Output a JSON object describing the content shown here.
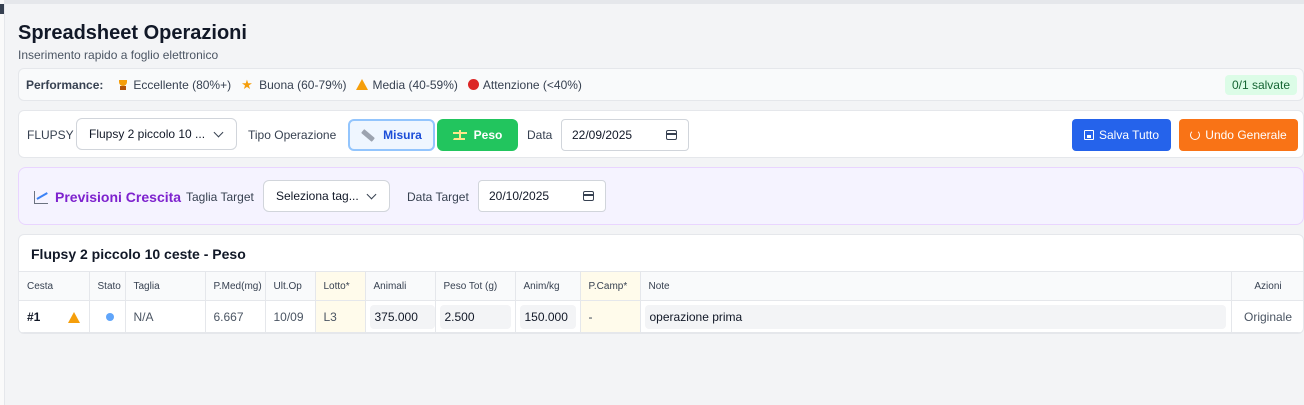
{
  "header": {
    "title": "Spreadsheet Operazioni",
    "subtitle": "Inserimento rapido a foglio elettronico"
  },
  "performance": {
    "label": "Performance:",
    "legend": [
      {
        "icon": "trophy-icon",
        "label": "Eccellente (80%+)"
      },
      {
        "icon": "star-icon",
        "label": "Buona (60-79%)"
      },
      {
        "icon": "warning-icon",
        "label": "Media (40-59%)"
      },
      {
        "icon": "red-dot-icon",
        "label": "Attenzione (<40%)"
      }
    ],
    "saved_badge": "0/1 salvate"
  },
  "toolbar": {
    "flupsy_label": "FLUPSY",
    "flupsy_value": "Flupsy 2 piccolo 10 ...",
    "operation_label": "Tipo Operazione",
    "misura_label": "Misura",
    "peso_label": "Peso",
    "date_label": "Data",
    "date_value": "22/09/2025",
    "save_all_label": "Salva Tutto",
    "undo_label": "Undo Generale"
  },
  "forecast": {
    "title": "Previsioni Crescita",
    "size_label": "Taglia Target",
    "size_value": "Seleziona tag...",
    "date_label": "Data Target",
    "date_value": "20/10/2025"
  },
  "grid": {
    "title": "Flupsy 2 piccolo 10 ceste - Peso",
    "columns": [
      "Cesta",
      "Stato",
      "Taglia",
      "P.Med(mg)",
      "Ult.Op",
      "Lotto*",
      "Animali",
      "Peso Tot (g)",
      "Anim/kg",
      "P.Camp*",
      "Note",
      "Azioni"
    ],
    "rows": [
      {
        "cesta": "#1",
        "taglia": "N/A",
        "p_med": "6.667",
        "ult_op": "10/09",
        "lotto": "L3",
        "animali": "375.000",
        "peso_tot": "2.500",
        "anim_kg": "150.000",
        "p_camp": "-",
        "note": "operazione prima",
        "azioni": "Originale"
      }
    ]
  },
  "colors": {
    "primary": "#2563eb",
    "success": "#22c55e",
    "warning": "#f97316",
    "accent_purple": "#7e22ce"
  }
}
